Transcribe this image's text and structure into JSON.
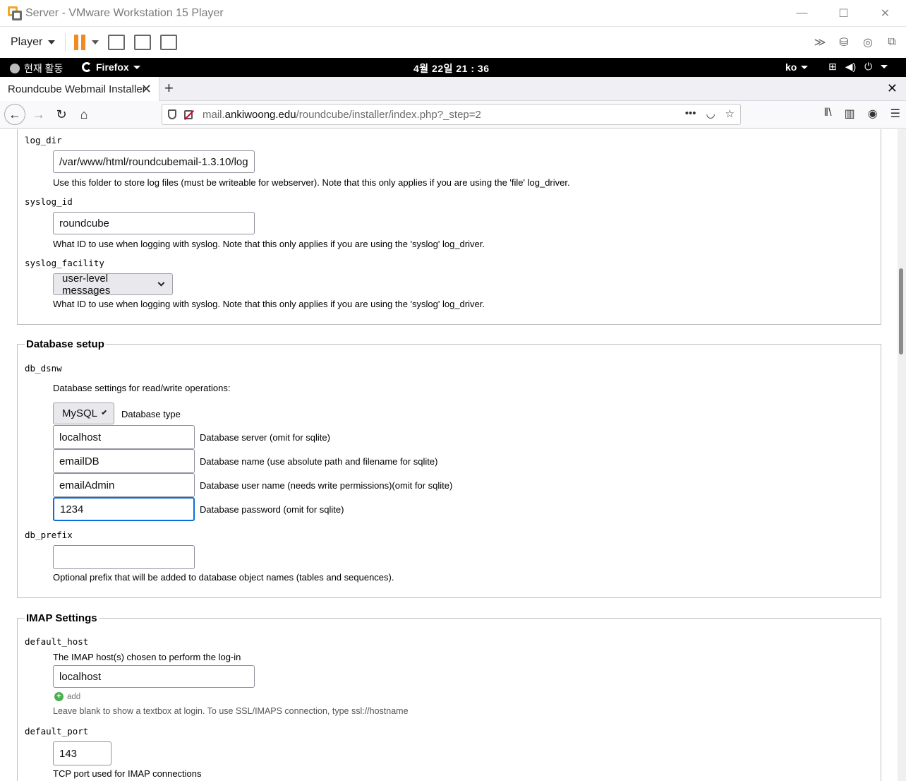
{
  "vmware": {
    "title": "Server - VMware Workstation 15 Player",
    "player_menu": "Player",
    "window_controls": {
      "minimize": "—",
      "maximize": "☐",
      "close": "✕"
    }
  },
  "gnome": {
    "activities": "현재 활동",
    "app": "Firefox",
    "clock": "4월 22일  21 : 36",
    "lang": "ko"
  },
  "browser": {
    "tab_title": "Roundcube Webmail Installer",
    "url_plain": "mail.",
    "url_domain": "ankiwoong.edu",
    "url_path": "/roundcube/installer/index.php?_step=2"
  },
  "logging": {
    "log_dir": {
      "label": "log_dir",
      "value": "/var/www/html/roundcubemail-1.3.10/log",
      "hint": "Use this folder to store log files (must be writeable for webserver). Note that this only applies if you are using the 'file' log_driver."
    },
    "syslog_id": {
      "label": "syslog_id",
      "value": "roundcube",
      "hint": "What ID to use when logging with syslog. Note that this only applies if you are using the 'syslog' log_driver."
    },
    "syslog_facility": {
      "label": "syslog_facility",
      "value": "user-level messages",
      "hint": "What ID to use when logging with syslog. Note that this only applies if you are using the 'syslog' log_driver."
    }
  },
  "database": {
    "legend": "Database setup",
    "db_dsnw_label": "db_dsnw",
    "db_dsnw_hint": "Database settings for read/write operations:",
    "type_value": "MySQL",
    "type_label": "Database type",
    "server_value": "localhost",
    "server_label": "Database server (omit for sqlite)",
    "name_value": "emailDB",
    "name_label": "Database name (use absolute path and filename for sqlite)",
    "user_value": "emailAdmin",
    "user_label": "Database user name (needs write permissions)(omit for sqlite)",
    "password_value": "1234",
    "password_label": "Database password (omit for sqlite)",
    "prefix_label": "db_prefix",
    "prefix_value": "",
    "prefix_hint": "Optional prefix that will be added to database object names (tables and sequences)."
  },
  "imap": {
    "legend": "IMAP Settings",
    "default_host_label": "default_host",
    "default_host_hint": "The IMAP host(s) chosen to perform the log-in",
    "default_host_value": "localhost",
    "add_label": "add",
    "default_host_note": "Leave blank to show a textbox at login. To use SSL/IMAPS connection, type ssl://hostname",
    "default_port_label": "default_port",
    "default_port_value": "143",
    "default_port_hint": "TCP port used for IMAP connections"
  }
}
